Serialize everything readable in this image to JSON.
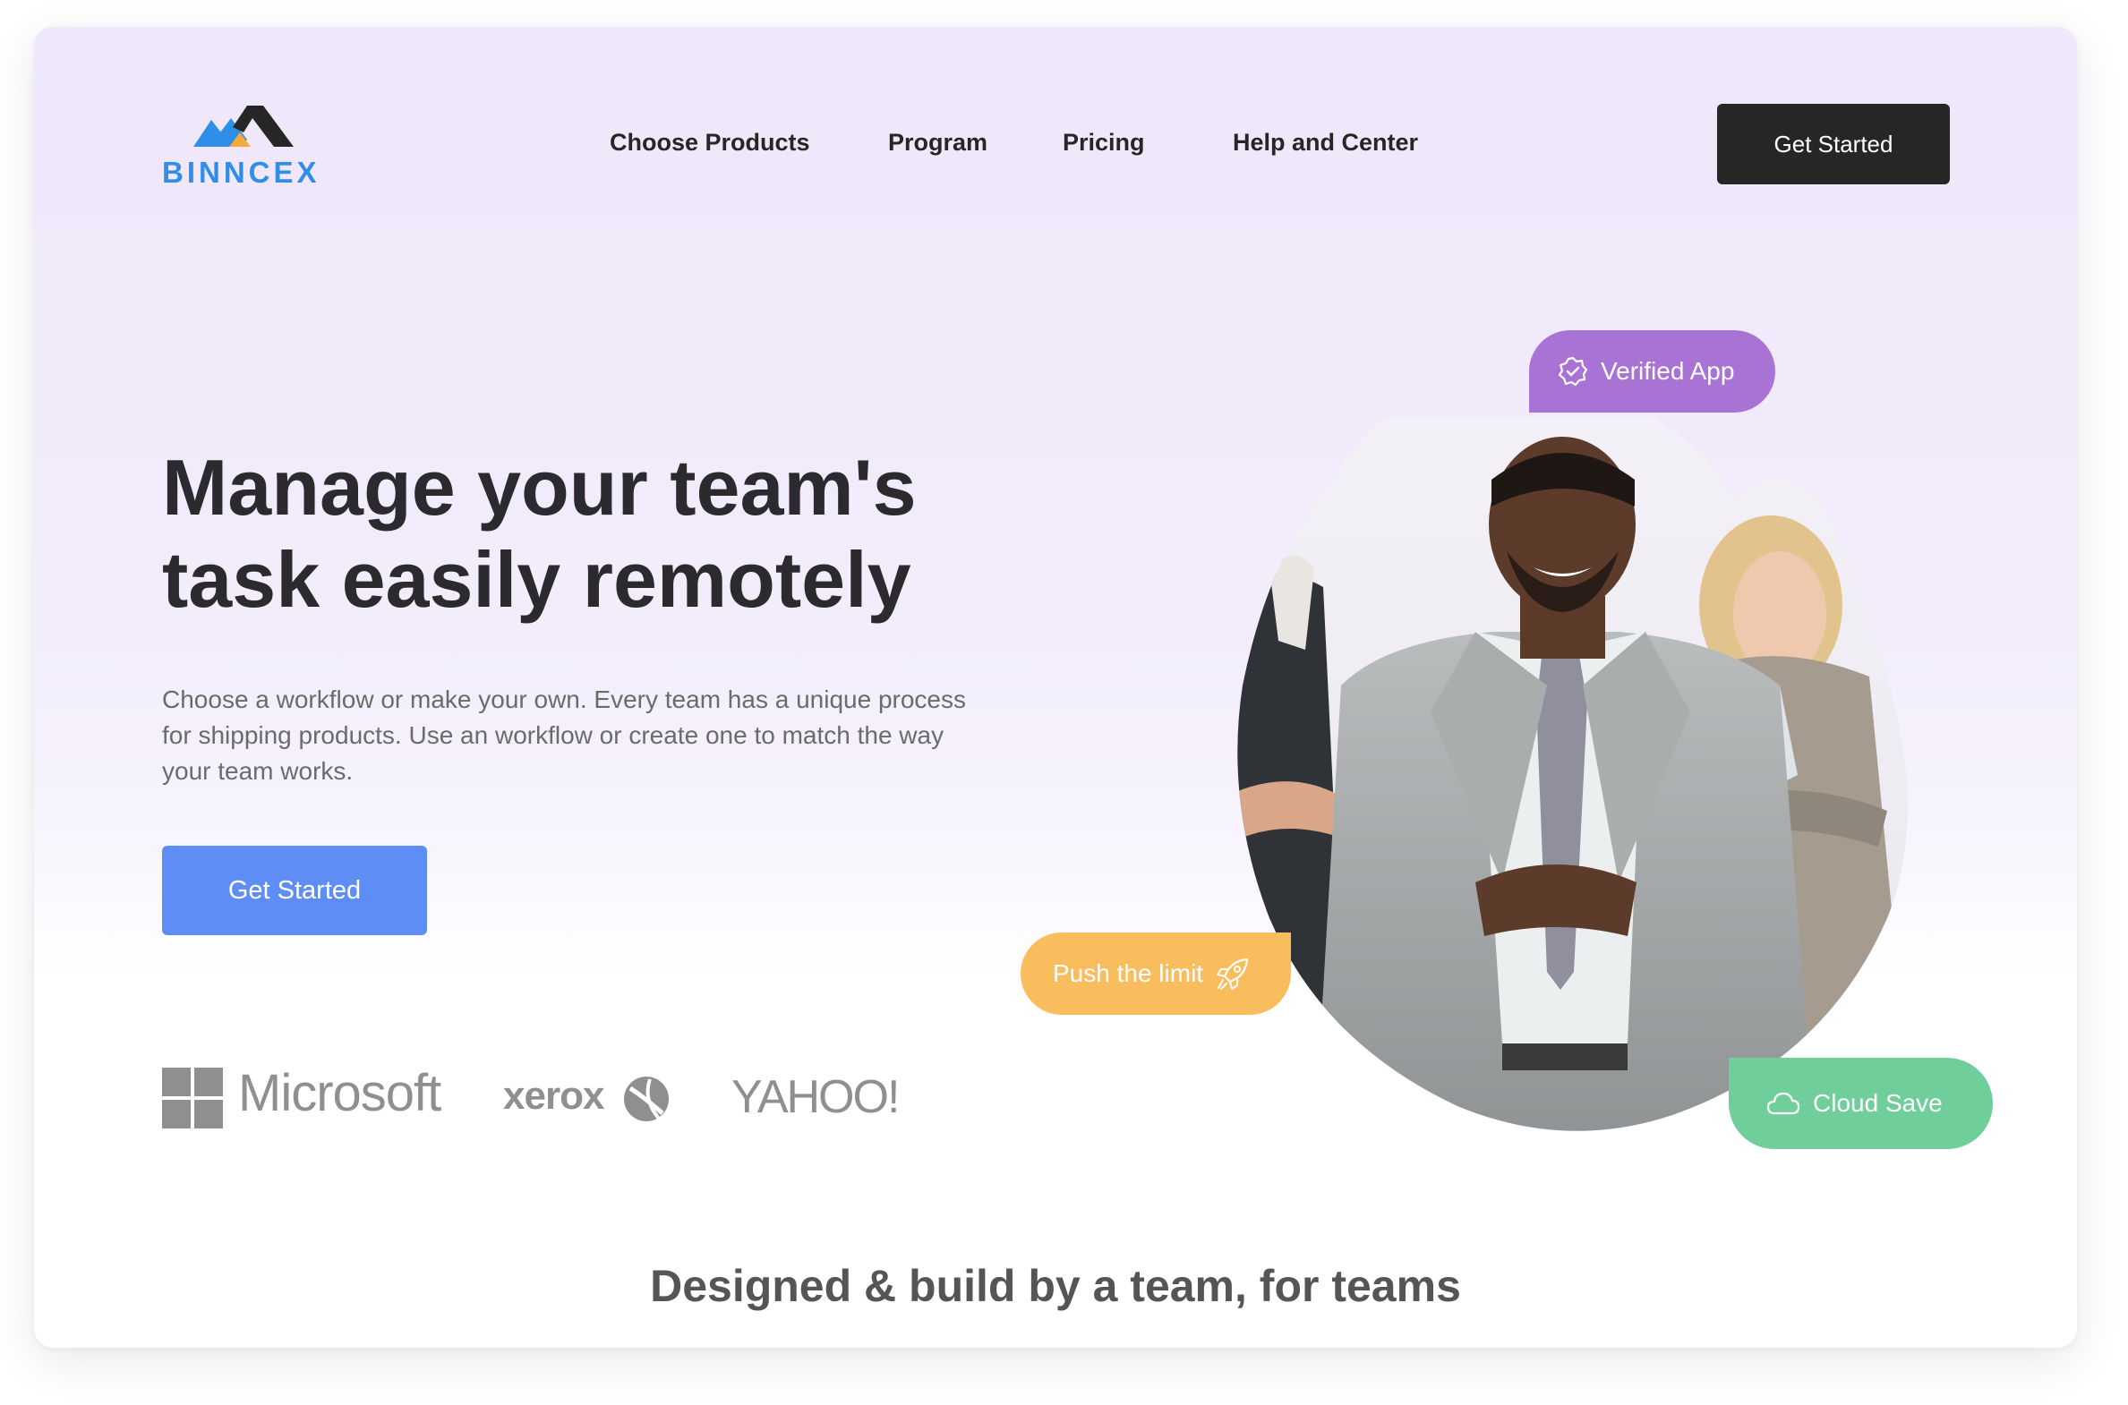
{
  "brand": {
    "name": "BINNCEX",
    "colors": {
      "primary": "#2e8ee8",
      "accent": "#f7a940",
      "dark": "#262626"
    }
  },
  "nav": {
    "items": [
      {
        "label": "Choose Products"
      },
      {
        "label": "Program"
      },
      {
        "label": "Pricing"
      },
      {
        "label": "Help and Center"
      }
    ],
    "cta_label": "Get Started"
  },
  "hero": {
    "headline_line1": "Manage your team's",
    "headline_line2": "task easily remotely",
    "description": "Choose a workflow or make your own. Every team has a unique process for shipping products. Use an workflow or create one to match the way your team works.",
    "cta_label": "Get Started",
    "cta_color": "#5e8df5"
  },
  "partners": {
    "microsoft": "Microsoft",
    "xerox": "xerox",
    "yahoo": "YAHOO!"
  },
  "badges": {
    "verified": {
      "label": "Verified App",
      "icon": "verified-badge-icon",
      "color": "#a873d4"
    },
    "push": {
      "label": "Push the limit",
      "icon": "rocket-icon",
      "color": "#f9bd5e"
    },
    "cloud": {
      "label": "Cloud Save",
      "icon": "cloud-icon",
      "color": "#6fce9a"
    }
  },
  "section": {
    "title": "Designed & build by a team, for teams"
  }
}
